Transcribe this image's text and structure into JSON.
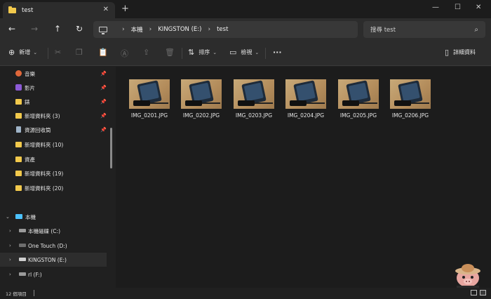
{
  "window": {
    "tab_title": "test",
    "tab_close": "✕",
    "new_tab": "+",
    "minimize": "—",
    "maximize": "☐",
    "close": "✕"
  },
  "navigation": {
    "back": "←",
    "forward": "→",
    "up": "↑",
    "refresh": "↻",
    "breadcrumb": [
      "本機",
      "KINGSTON (E:)",
      "test"
    ],
    "search_placeholder": "搜尋 test"
  },
  "toolbar": {
    "new_label": "新增",
    "sort_label": "排序",
    "view_label": "檢視",
    "more": "···",
    "details_label": "詳細資料"
  },
  "sidebar": {
    "quick_access": [
      {
        "label": "音樂",
        "pinned": true,
        "icon": "music-icon"
      },
      {
        "label": "影片",
        "pinned": true,
        "icon": "video-icon"
      },
      {
        "label": "錶",
        "pinned": true,
        "icon": "folder-icon"
      },
      {
        "label": "新增資料夾 (3)",
        "pinned": true,
        "icon": "folder-icon"
      },
      {
        "label": "資源回收筒",
        "pinned": true,
        "icon": "recycle-bin-icon"
      },
      {
        "label": "新增資料夾 (10)",
        "pinned": false,
        "icon": "folder-icon"
      },
      {
        "label": "資產",
        "pinned": false,
        "icon": "folder-icon"
      },
      {
        "label": "新增資料夾 (19)",
        "pinned": false,
        "icon": "folder-icon"
      },
      {
        "label": "新增資料夾 (20)",
        "pinned": false,
        "icon": "folder-icon"
      }
    ],
    "this_pc": "本機",
    "drives": [
      {
        "label": "本機磁碟 (C:)",
        "icon": "drive-icon"
      },
      {
        "label": "One Touch (D:)",
        "icon": "drive-icon"
      },
      {
        "label": "KINGSTON (E:)",
        "icon": "usb-drive-icon",
        "selected": true
      },
      {
        "label": "rl (F:)",
        "icon": "drive-icon"
      }
    ]
  },
  "files": [
    {
      "name": "IMG_0201.JPG"
    },
    {
      "name": "IMG_0202.JPG"
    },
    {
      "name": "IMG_0203.JPG"
    },
    {
      "name": "IMG_0204.JPG"
    },
    {
      "name": "IMG_0205.JPG"
    },
    {
      "name": "IMG_0206.JPG"
    }
  ],
  "status": {
    "item_count": "12 個項目"
  },
  "colors": {
    "folder": "#f2c94c",
    "accent": "#4cc2ff",
    "background": "#202020"
  }
}
